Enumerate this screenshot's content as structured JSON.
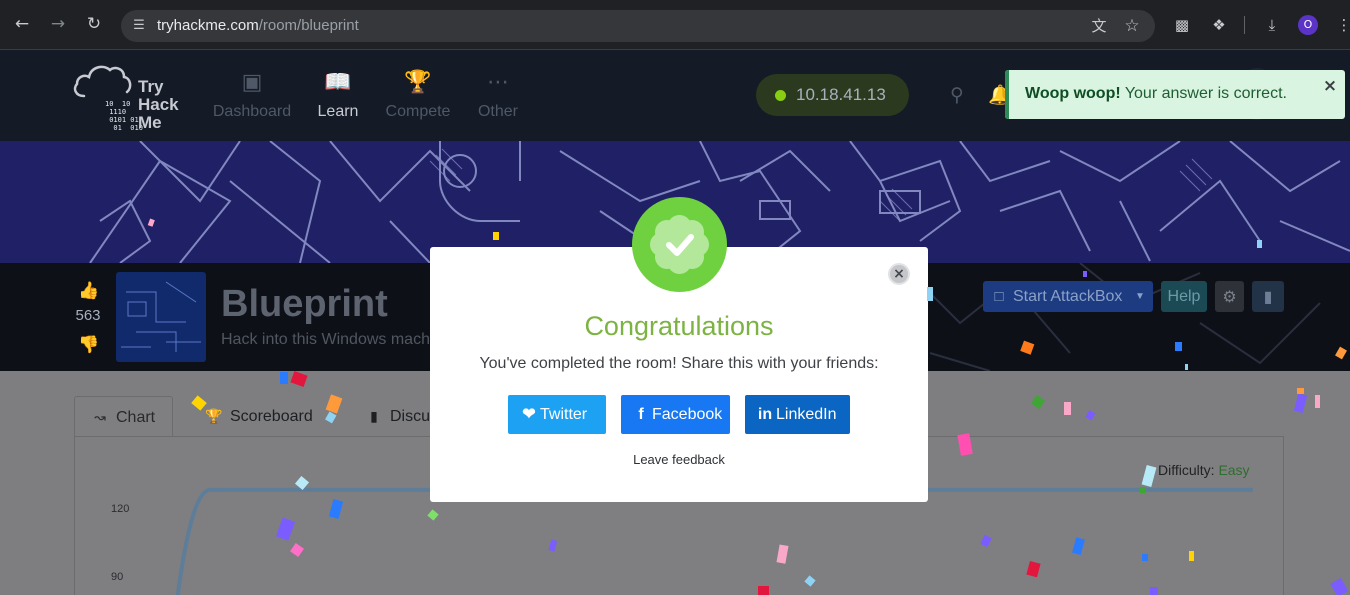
{
  "browser": {
    "url_domain": "tryhackme.com",
    "url_path": "/room/blueprint",
    "profile_initial": "O",
    "icons": [
      "back-icon",
      "forward-icon",
      "reload-icon",
      "site-settings-icon",
      "translate-icon",
      "star-icon",
      "qr-code-icon",
      "extensions-icon",
      "download-icon",
      "menu-icon"
    ]
  },
  "header": {
    "logo_text": [
      "Try",
      "Hack",
      "Me"
    ],
    "logo_bits": "10  10\n 1110\n 0101 01\n  01  010",
    "nav": [
      {
        "label": "Dashboard",
        "icon": "dashboard-icon"
      },
      {
        "label": "Learn",
        "icon": "book-icon"
      },
      {
        "label": "Compete",
        "icon": "trophy-icon"
      },
      {
        "label": "Other",
        "icon": "more-icon"
      }
    ],
    "active_nav": "Learn",
    "ip_address": "10.18.41.13",
    "accent": "#88cc14"
  },
  "toast": {
    "strong": "Woop woop!",
    "message": "Your answer is correct.",
    "close": "×"
  },
  "room": {
    "votes": "563",
    "title": "Blueprint",
    "subtitle": "Hack into this Windows mach",
    "attackbox_label": "Start AttackBox",
    "help_label": "Help"
  },
  "tabs": [
    {
      "label": "Chart",
      "icon": "chart-icon"
    },
    {
      "label": "Scoreboard",
      "icon": "trophy-icon"
    },
    {
      "label": "Discu",
      "icon": "comments-icon"
    }
  ],
  "chart": {
    "difficulty_label": "Difficulty:",
    "difficulty_value": "Easy",
    "ytick_top": "120",
    "ytick_mid": "90"
  },
  "chart_data": {
    "type": "line",
    "series": [
      {
        "values": [
          0,
          111,
          111
        ]
      }
    ],
    "ylim": [
      80,
      125
    ]
  },
  "modal": {
    "title": "Congratulations",
    "message": "You've completed the room! Share this with your friends:",
    "twitter": "Twitter",
    "facebook": "Facebook",
    "linkedin": "LinkedIn",
    "feedback": "Leave feedback",
    "close": "×",
    "colors": {
      "success": "#6fd13f",
      "title": "#7cb342",
      "twitter": "#1da1f2",
      "facebook": "#1877f2",
      "linkedin": "#0a66c2"
    }
  }
}
